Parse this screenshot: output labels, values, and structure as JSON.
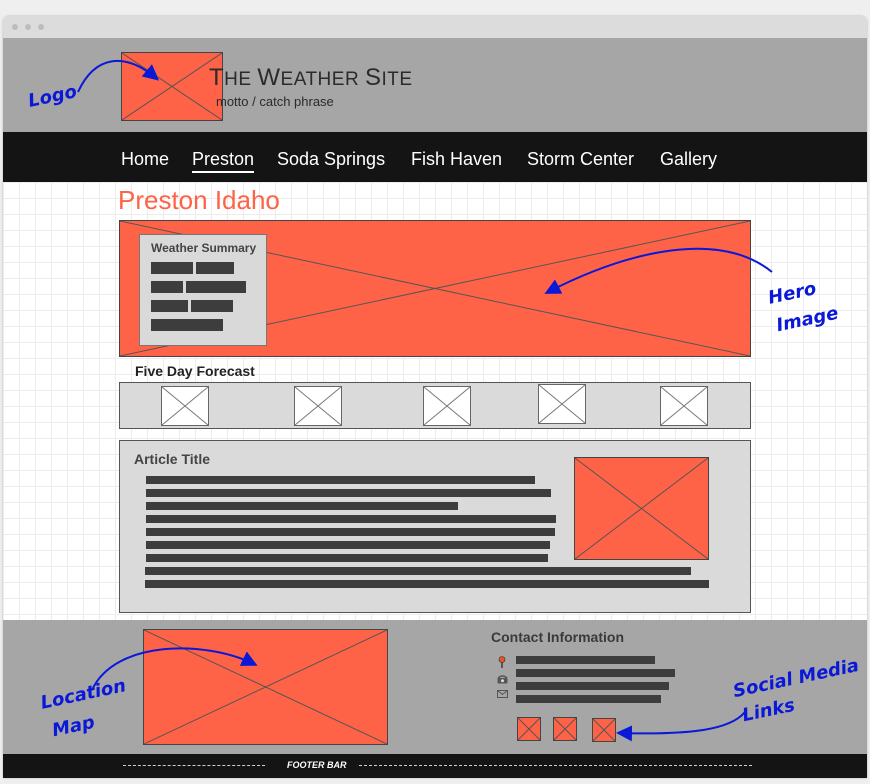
{
  "site": {
    "title_first": "T",
    "title_rest_1": "HE ",
    "title_second": "W",
    "title_rest_2": "EATHER ",
    "title_third": "S",
    "title_rest_3": "ITE",
    "motto": "motto / catch phrase"
  },
  "nav": {
    "items": [
      "Home",
      "Preston",
      "Soda Springs",
      "Fish Haven",
      "Storm Center",
      "Gallery"
    ],
    "active": "Preston"
  },
  "page": {
    "heading": "Preston Idaho",
    "weather_summary_title": "Weather Summary",
    "forecast_title": "Five Day Forecast",
    "article_title": "Article Title"
  },
  "footer": {
    "contact_title": "Contact Information",
    "footer_bar_text": "FOOTER BAR"
  },
  "annotations": {
    "logo": "Logo",
    "hero_line1": "Hero",
    "hero_line2": "Image",
    "location_line1": "Location",
    "location_line2": "Map",
    "social_line1": "Social Media",
    "social_line2": "Links"
  },
  "colors": {
    "placeholder": "#ff6347",
    "annotation": "#0a18d8",
    "header_bg": "#a6a6a6",
    "nav_bg": "#141414",
    "accent_heading": "#ff6347"
  }
}
